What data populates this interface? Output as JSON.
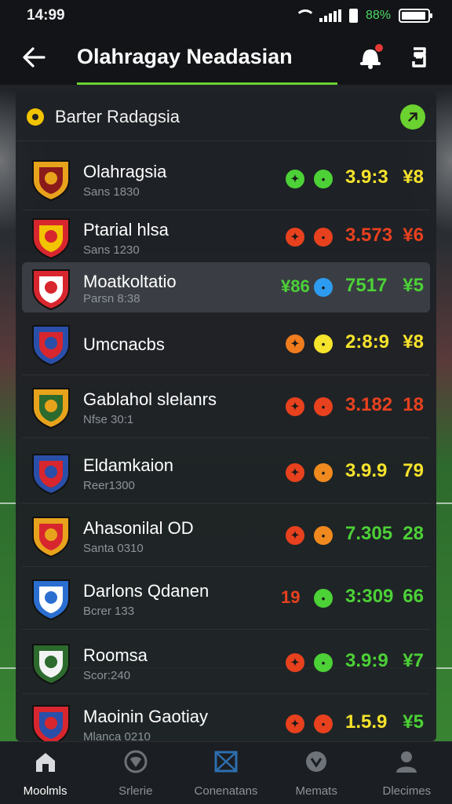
{
  "status": {
    "time": "14:99",
    "battery_pct": "88%"
  },
  "header": {
    "title": "Olahragay Neadasian"
  },
  "card": {
    "title": "Barter Radagsia",
    "rows": [
      {
        "name": "Olahragsia",
        "sub": "Sans 1830",
        "p1_color": "#4cd137",
        "p2_color": "#4cd137",
        "odds": "3.9:3",
        "odds_color": "#f6e32b",
        "val": "¥8",
        "val_color": "#f6e32b",
        "crest_main": "#e8a31c",
        "crest_accent": "#8b1a1a"
      },
      {
        "name": "Ptarial hlsa",
        "sub": "Sans 1230",
        "p1_color": "#e8411e",
        "p2_color": "#e8411e",
        "odds": "3.573",
        "odds_color": "#e8411e",
        "val": "¥6",
        "val_color": "#e8411e",
        "crest_main": "#d8262e",
        "crest_accent": "#f2c300"
      },
      {
        "name": "Moatkoltatio",
        "sub": "Parsn 8:38",
        "p1_text": "¥86",
        "p1_color": "#4cd137",
        "p2_color": "#2d9cf0",
        "odds": "7517",
        "odds_color": "#4cd137",
        "val": "¥5",
        "val_color": "#4cd137",
        "crest_main": "#d8262e",
        "crest_accent": "#ffffff"
      },
      {
        "name": "Umcnacbs",
        "sub": "",
        "p1_color": "#f07c1e",
        "p2_color": "#f6e32b",
        "odds": "2:8:9",
        "odds_color": "#f6e32b",
        "val": "¥8",
        "val_color": "#f6e32b",
        "crest_main": "#2a4fa8",
        "crest_accent": "#d8262e"
      },
      {
        "name": "Gablahol slelanrs",
        "sub": "Nfse 30:1",
        "p1_color": "#e8411e",
        "p2_color": "#e8411e",
        "odds": "3.182",
        "odds_color": "#e8411e",
        "val": "18",
        "val_color": "#e8411e",
        "crest_main": "#e8a31c",
        "crest_accent": "#2d6a2d"
      },
      {
        "name": "Eldamkaion",
        "sub": "Reer1300",
        "p1_color": "#e8411e",
        "p2_color": "#f08a1e",
        "odds": "3.9.9",
        "odds_color": "#f6e32b",
        "val": "79",
        "val_color": "#f6e32b",
        "crest_main": "#2a4fa8",
        "crest_accent": "#d8262e"
      },
      {
        "name": "Ahasonilal OD",
        "sub": "Santa 0310",
        "p1_color": "#e8411e",
        "p2_color": "#f08a1e",
        "odds": "7.305",
        "odds_color": "#4cd137",
        "val": "28",
        "val_color": "#4cd137",
        "crest_main": "#e8a31c",
        "crest_accent": "#d8262e"
      },
      {
        "name": "Darlons Qdanen",
        "sub": "Bcrer 133",
        "p1_text": "19",
        "p1_color": "#e8411e",
        "p2_color": "#4cd137",
        "odds": "3:309",
        "odds_color": "#4cd137",
        "val": "66",
        "val_color": "#4cd137",
        "crest_main": "#2a6fd0",
        "crest_accent": "#ffffff"
      },
      {
        "name": "Roomsa",
        "sub": "Scor:240",
        "p1_color": "#e8411e",
        "p2_color": "#4cd137",
        "odds": "3.9:9",
        "odds_color": "#4cd137",
        "val": "¥7",
        "val_color": "#4cd137",
        "crest_main": "#2d6a2d",
        "crest_accent": "#f2f2f2"
      },
      {
        "name": "Maoinin Gaotiay",
        "sub": "Mlanca 0210",
        "p1_color": "#e8411e",
        "p2_color": "#e8411e",
        "odds": "1.5.9",
        "odds_color": "#f6e32b",
        "val": "¥5",
        "val_color": "#4cd137",
        "crest_main": "#d8262e",
        "crest_accent": "#2a4fa8"
      }
    ]
  },
  "nav": [
    {
      "label": "Moolmls",
      "icon": "home-icon",
      "active": true
    },
    {
      "label": "Srlerie",
      "icon": "shield-icon",
      "active": false
    },
    {
      "label": "Conenatans",
      "icon": "pitch-icon",
      "active": false
    },
    {
      "label": "Memats",
      "icon": "badge-icon",
      "active": false
    },
    {
      "label": "Dlecimes",
      "icon": "profile-icon",
      "active": false
    }
  ]
}
